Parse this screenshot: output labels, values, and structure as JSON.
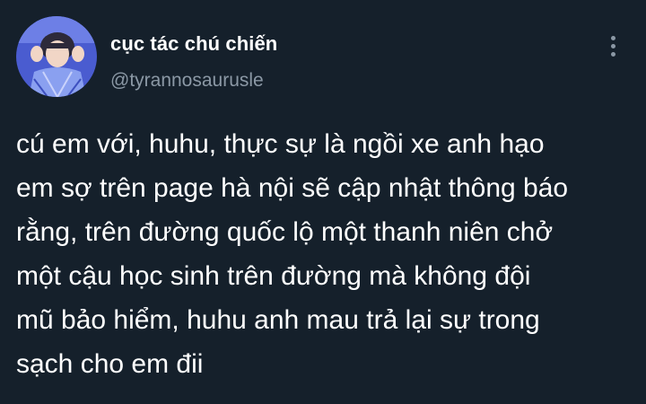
{
  "author": {
    "display_name": "cục tác chú chiến",
    "handle": "@tyrannosaurusle"
  },
  "tweet": {
    "lines": [
      "cú em với, huhu, thực sự là ngồi xe anh hạo",
      "em sợ trên page hà nội sẽ cập nhật thông báo",
      "rằng, trên đường quốc lộ một thanh niên chở",
      "một cậu học sinh trên đường mà không đội",
      "mũ bảo hiểm, huhu anh mau trả lại sự trong",
      "sạch cho em đii"
    ]
  },
  "icons": {
    "more": "more-vertical-icon",
    "avatar": "profile-photo"
  },
  "colors": {
    "background": "#15202b",
    "text": "#ffffff",
    "secondary": "#8b98a5",
    "avatar_bg": "#4a5cd0"
  }
}
